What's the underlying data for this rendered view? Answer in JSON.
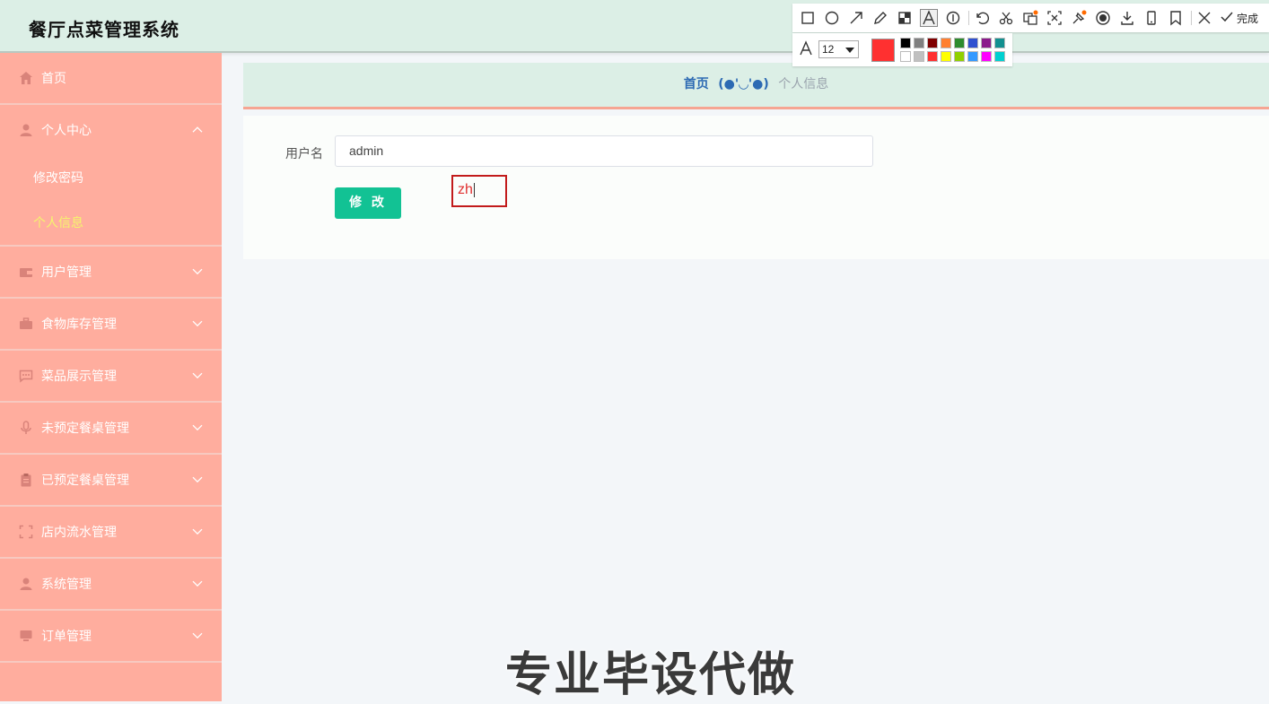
{
  "header": {
    "title": "餐厅点菜管理系统"
  },
  "sidebar": {
    "home": {
      "label": "首页",
      "icon": "home-icon"
    },
    "personal_center": {
      "label": "个人中心",
      "icon": "user-icon",
      "items": [
        {
          "label": "修改密码",
          "active": false
        },
        {
          "label": "个人信息",
          "active": true
        }
      ]
    },
    "menus": [
      {
        "label": "用户管理",
        "icon": "wallet-icon"
      },
      {
        "label": "食物库存管理",
        "icon": "briefcase-icon"
      },
      {
        "label": "菜品展示管理",
        "icon": "chat-icon"
      },
      {
        "label": "未预定餐桌管理",
        "icon": "microphone-icon"
      },
      {
        "label": "已预定餐桌管理",
        "icon": "clipboard-icon"
      },
      {
        "label": "店内流水管理",
        "icon": "fullscreen-icon"
      },
      {
        "label": "系统管理",
        "icon": "user-icon"
      },
      {
        "label": "订单管理",
        "icon": "monitor-icon"
      }
    ]
  },
  "breadcrumb": {
    "home": "首页",
    "separator": "(●'◡'●)",
    "current": "个人信息"
  },
  "form": {
    "username_label": "用户名",
    "username_value": "admin",
    "save_button": "修 改"
  },
  "annotation": {
    "text": "zh"
  },
  "screenshot_tool": {
    "done_label": "完成",
    "font_size": "12",
    "current_color": "#ff3030",
    "palette": [
      "#000000",
      "#808080",
      "#800000",
      "#ff8030",
      "#2e8b2e",
      "#3050d0",
      "#8b1a8b",
      "#139090",
      "#ffffff",
      "#c0c0c0",
      "#ff3030",
      "#ffff00",
      "#90d000",
      "#3399ff",
      "#ff00ff",
      "#00d0d0"
    ]
  },
  "watermark": "专业毕设代做"
}
